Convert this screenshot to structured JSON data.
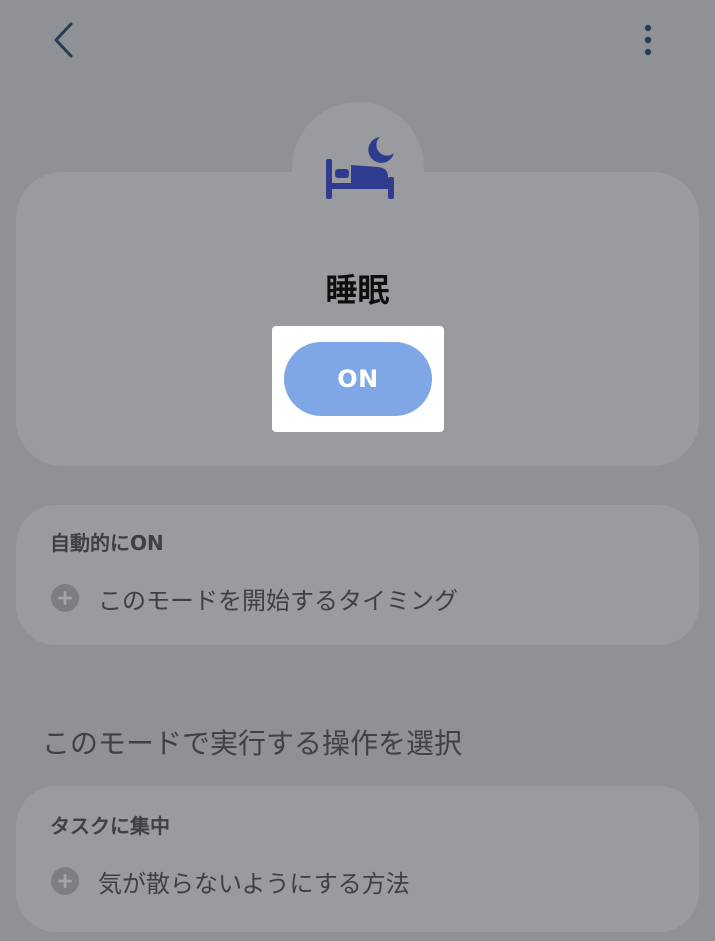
{
  "header": {
    "back_icon": "chevron-left-icon",
    "more_icon": "vertical-ellipsis-icon"
  },
  "hero": {
    "icon": "bed-moon-icon",
    "title": "睡眠",
    "toggle_label": "ON",
    "toggle_color": "#7fa7e6"
  },
  "auto_on": {
    "title": "自動的にON",
    "row_icon": "plus-circle-icon",
    "row_label": "このモードを開始するタイミング"
  },
  "actions": {
    "heading": "このモードで実行する操作を選択"
  },
  "focus": {
    "title": "タスクに集中",
    "row_icon": "plus-circle-icon",
    "row_label": "気が散らないようにする方法"
  },
  "colors": {
    "scrim": "#8f9194",
    "card": "#999b9e",
    "icon_accent": "#2f3b8f"
  }
}
